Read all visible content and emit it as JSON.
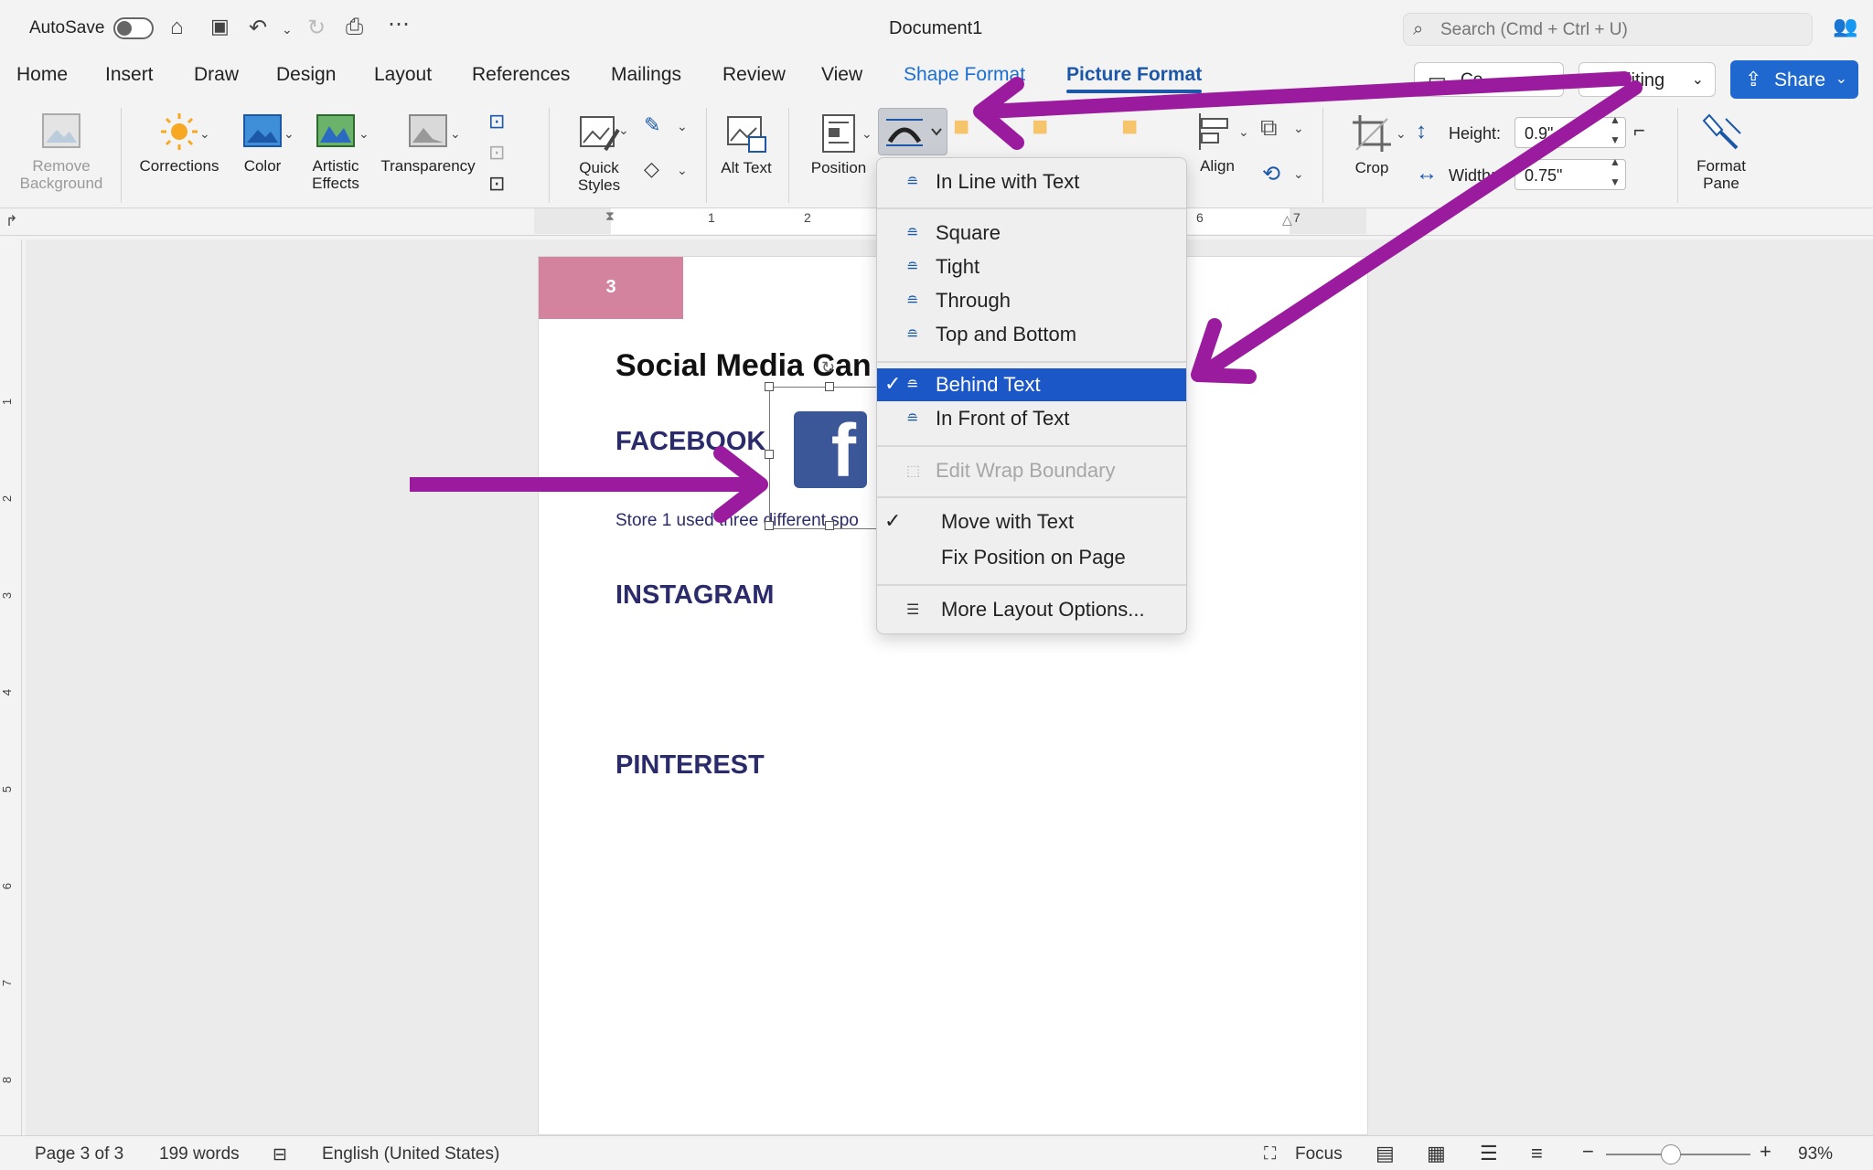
{
  "titlebar": {
    "autosave_label": "AutoSave",
    "document_title": "Document1",
    "search_placeholder": "Search (Cmd + Ctrl + U)"
  },
  "tabs": [
    "Home",
    "Insert",
    "Draw",
    "Design",
    "Layout",
    "References",
    "Mailings",
    "Review",
    "View",
    "Shape Format",
    "Picture Format"
  ],
  "header_buttons": {
    "comments_label": "Co",
    "editing_label": "Editing",
    "share_label": "Share"
  },
  "ribbon": {
    "remove_background": "Remove Background",
    "corrections": "Corrections",
    "color": "Color",
    "artistic_effects": "Artistic Effects",
    "transparency": "Transparency",
    "quick_styles": "Quick Styles",
    "alt_text": "Alt Text",
    "position": "Position",
    "align": "Align",
    "crop": "Crop",
    "height_label": "Height:",
    "height_value": "0.9\"",
    "width_label": "Width:",
    "width_value": "0.75\"",
    "format_pane": "Format Pane"
  },
  "ruler": [
    "1",
    "2",
    "6",
    "7"
  ],
  "vertical_ruler": [
    "1",
    "2",
    "3",
    "4",
    "5",
    "6",
    "7",
    "8"
  ],
  "document": {
    "page_number": "3",
    "heading": "Social Media Can",
    "facebook": "FACEBOOK",
    "body": "Store 1 used three different spo",
    "instagram": "INSTAGRAM",
    "pinterest": "PINTEREST"
  },
  "wrap_menu": {
    "items": [
      {
        "label": "In Line with Text"
      },
      {
        "label": "Square"
      },
      {
        "label": "Tight"
      },
      {
        "label": "Through"
      },
      {
        "label": "Top and Bottom"
      },
      {
        "label": "Behind Text",
        "selected": true
      },
      {
        "label": "In Front of Text"
      },
      {
        "label": "Edit Wrap Boundary",
        "disabled": true
      },
      {
        "label": "Move with Text",
        "checked": true
      },
      {
        "label": "Fix Position on Page"
      },
      {
        "label": "More Layout Options..."
      }
    ]
  },
  "statusbar": {
    "page": "Page 3 of 3",
    "words": "199 words",
    "language": "English (United States)",
    "focus": "Focus",
    "zoom": "93%"
  },
  "colors": {
    "accent": "#1c57a8",
    "arrow": "#9b1b9f",
    "heading_purple": "#2b2a6b",
    "page_tab": "#d4839e",
    "share": "#1e68d0",
    "menu_selected": "#1c57c8"
  }
}
